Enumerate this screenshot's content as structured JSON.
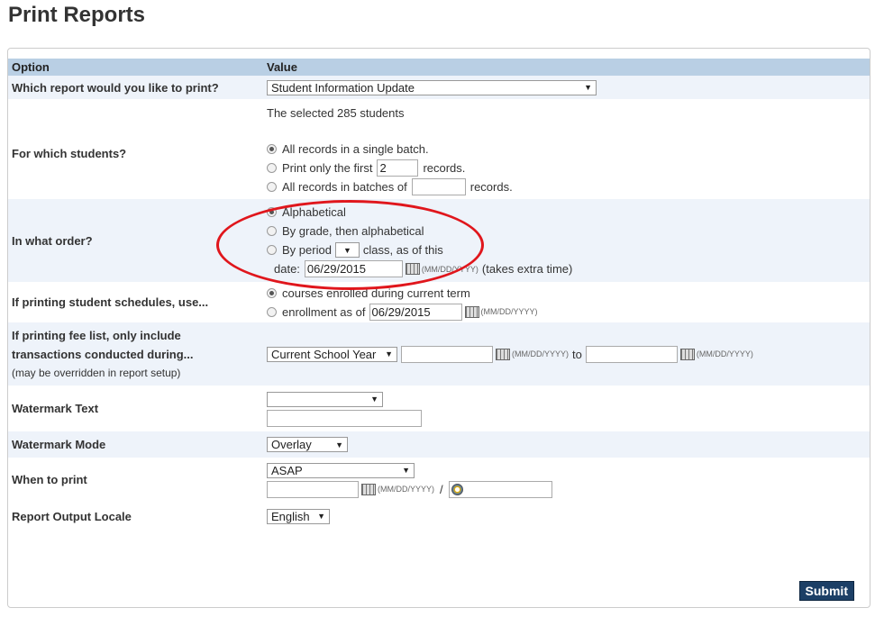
{
  "page_title": "Print Reports",
  "header": {
    "option": "Option",
    "value": "Value"
  },
  "report": {
    "label": "Which report would you like to print?",
    "selected": "Student Information Update"
  },
  "students": {
    "label": "For which students?",
    "selected_text": "The selected 285 students",
    "opt_all": "All records in a single batch.",
    "opt_first_pre": "Print only the first",
    "opt_first_value": "2",
    "opt_first_post": "records.",
    "opt_batch_pre": "All records in batches of",
    "opt_batch_value": "",
    "opt_batch_post": "records."
  },
  "order": {
    "label": "In what order?",
    "opt_alpha": "Alphabetical",
    "opt_grade": "By grade, then alphabetical",
    "opt_period_pre": "By period",
    "opt_period_post": "class, as of this",
    "date_label": "date:",
    "date_value": "06/29/2015",
    "date_format": "(MM/DD/YYYY)",
    "note": "(takes extra time)"
  },
  "schedules": {
    "label": "If printing student schedules, use...",
    "opt_current": "courses enrolled during current term",
    "opt_asof": "enrollment as of",
    "date_value": "06/29/2015",
    "date_format": "(MM/DD/YYYY)"
  },
  "fee": {
    "label_line1": "If printing fee list, only include",
    "label_line2": "transactions conducted during...",
    "note": "(may be overridden in report setup)",
    "period": "Current School Year",
    "date_format": "(MM/DD/YYYY)",
    "to": "to"
  },
  "watermark_text": {
    "label": "Watermark Text"
  },
  "watermark_mode": {
    "label": "Watermark Mode",
    "selected": "Overlay"
  },
  "when": {
    "label": "When to print",
    "selected": "ASAP",
    "date_format": "(MM/DD/YYYY)",
    "sep": "/"
  },
  "locale": {
    "label": "Report Output Locale",
    "selected": "English"
  },
  "submit": "Submit",
  "colors": {
    "header_bg": "#b9cfe4",
    "alt_row": "#eef3fa",
    "annotation": "#e0161c",
    "submit_bg": "#1c3f66"
  }
}
